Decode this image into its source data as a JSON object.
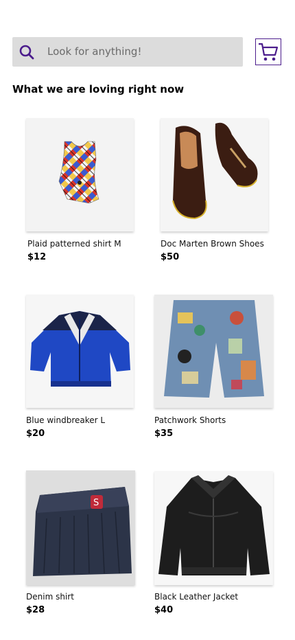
{
  "search": {
    "placeholder": "Look for anything!",
    "icon": "search-icon"
  },
  "cart": {
    "icon": "shopping-cart-icon",
    "color": "#4b1c8c"
  },
  "section": {
    "title": "What we are loving right now"
  },
  "products": [
    {
      "name": "Plaid patterned shirt M",
      "price": "$12"
    },
    {
      "name": "Doc Marten Brown Shoes",
      "price": "$50"
    },
    {
      "name": "Blue windbreaker L",
      "price": "$20"
    },
    {
      "name": "Patchwork Shorts",
      "price": "$35"
    },
    {
      "name": "Denim shirt",
      "price": "$28"
    },
    {
      "name": "Black Leather Jacket",
      "price": "$40"
    }
  ]
}
